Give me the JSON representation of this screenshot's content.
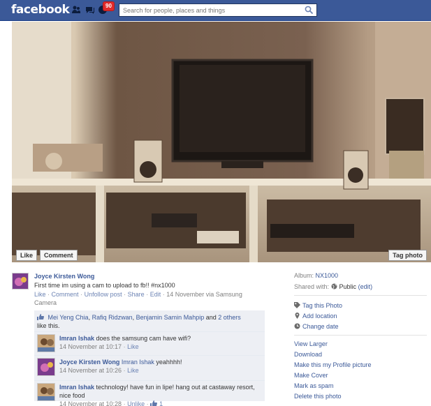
{
  "topbar": {
    "logo": "facebook",
    "notifications_count": "90",
    "search_placeholder": "Search for people, places and things"
  },
  "photo": {
    "like_button": "Like",
    "comment_button": "Comment",
    "tag_button": "Tag photo"
  },
  "post": {
    "author": "Joyce Kirsten Wong",
    "text": "First time im using a cam to upload to fb!! #nx1000",
    "actions": {
      "like": "Like",
      "comment": "Comment",
      "unfollow": "Unfollow post",
      "share": "Share",
      "edit": "Edit",
      "separator": "·"
    },
    "time": "14 November via Samsung Camera"
  },
  "likes": {
    "names": [
      "Mei Yeng Chia",
      "Rafiq Ridzwan",
      "Benjamin Samin Mahpip"
    ],
    "comma": ",",
    "and_word": "and",
    "others_link": "2 others",
    "suffix": "like this."
  },
  "comments": [
    {
      "author": "Imran Ishak",
      "text": "does the samsung cam have wifi?",
      "time": "14 November at 10:17",
      "action": "Like"
    },
    {
      "author": "Joyce Kirsten Wong",
      "mention": "Imran Ishak",
      "text": "yeahhhh!",
      "time": "14 November at 10:26",
      "action": "Like"
    },
    {
      "author": "Imran Ishak",
      "text": "technology! have fun in lipe! hang out at castaway resort, nice food",
      "time": "14 November at 10:28",
      "action": "Unlike",
      "like_count": "1"
    }
  ],
  "sidebar": {
    "album_label": "Album:",
    "album_name": "NX1000",
    "shared_label": "Shared with:",
    "privacy": "Public",
    "edit_privacy": "(edit)",
    "tag_photo": "Tag this Photo",
    "add_location": "Add location",
    "change_date": "Change date",
    "view_larger": "View Larger",
    "download": "Download",
    "make_profile": "Make this my Profile picture",
    "make_cover": "Make Cover",
    "mark_spam": "Mark as spam",
    "delete_photo": "Delete this photo"
  },
  "colors": {
    "brand": "#3b5998",
    "link": "#3b5998",
    "badge": "#e02b2b",
    "comment_bg": "#edeff4"
  }
}
